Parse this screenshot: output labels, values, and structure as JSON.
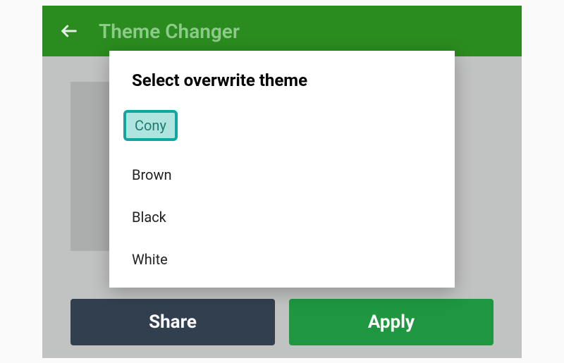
{
  "header": {
    "title": "Theme Changer"
  },
  "buttons": {
    "share": "Share",
    "apply": "Apply"
  },
  "dialog": {
    "title": "Select overwrite theme",
    "options": [
      "Cony",
      "Brown",
      "Black",
      "White"
    ],
    "selected_index": 0
  },
  "colors": {
    "header_bg": "#2b8f1f",
    "apply_bg": "#1f9b42",
    "share_bg": "#344150",
    "highlight_border": "#0fa8a0",
    "highlight_fill": "#b0e5df"
  }
}
